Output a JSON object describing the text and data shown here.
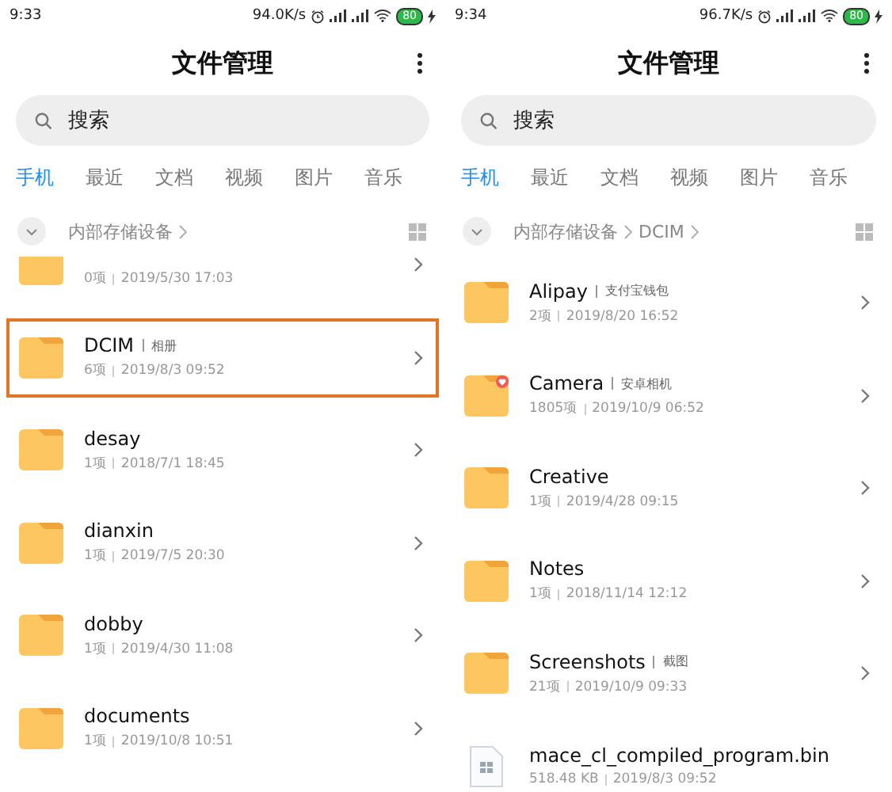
{
  "screens": [
    {
      "status_bar": {
        "time": "9:33",
        "speed": "94.0K/s",
        "battery": "80"
      },
      "title": "文件管理",
      "search": {
        "placeholder": "搜索"
      },
      "tabs": [
        {
          "label": "手机",
          "selected": true
        },
        {
          "label": "最近",
          "selected": false
        },
        {
          "label": "文档",
          "selected": false
        },
        {
          "label": "视频",
          "selected": false
        },
        {
          "label": "图片",
          "selected": false
        },
        {
          "label": "音乐",
          "selected": false
        }
      ],
      "breadcrumb": [
        "内部存储设备"
      ],
      "items": [
        {
          "kind": "folder",
          "info": "0项",
          "date": "2019/5/30 17:03",
          "highlighted": false
        },
        {
          "kind": "folder",
          "name": "DCIM",
          "tag": "相册",
          "info": "6项",
          "date": "2019/8/3 09:52",
          "highlighted": true,
          "favorite": false
        },
        {
          "kind": "folder",
          "name": "desay",
          "info": "1项",
          "date": "2018/7/1 18:45",
          "highlighted": false,
          "favorite": false
        },
        {
          "kind": "folder",
          "name": "dianxin",
          "info": "1项",
          "date": "2019/7/5 20:30",
          "highlighted": false,
          "favorite": false
        },
        {
          "kind": "folder",
          "name": "dobby",
          "info": "1项",
          "date": "2019/4/30 11:08",
          "highlighted": false,
          "favorite": false
        },
        {
          "kind": "folder",
          "name": "documents",
          "info": "1项",
          "date": "2019/10/8 10:51",
          "highlighted": false,
          "favorite": false
        }
      ]
    },
    {
      "status_bar": {
        "time": "9:34",
        "speed": "96.7K/s",
        "battery": "80"
      },
      "title": "文件管理",
      "search": {
        "placeholder": "搜索"
      },
      "tabs": [
        {
          "label": "手机",
          "selected": true
        },
        {
          "label": "最近",
          "selected": false
        },
        {
          "label": "文档",
          "selected": false
        },
        {
          "label": "视频",
          "selected": false
        },
        {
          "label": "图片",
          "selected": false
        },
        {
          "label": "音乐",
          "selected": false
        }
      ],
      "breadcrumb": [
        "内部存储设备",
        "DCIM"
      ],
      "items": [
        {
          "kind": "folder",
          "name": "Alipay",
          "tag": "支付宝钱包",
          "info": "2项",
          "date": "2019/8/20 16:52",
          "highlighted": false,
          "favorite": false
        },
        {
          "kind": "folder",
          "name": "Camera",
          "tag": "安卓相机",
          "info": "1805项",
          "date": "2019/10/9 06:52",
          "highlighted": false,
          "favorite": true
        },
        {
          "kind": "folder",
          "name": "Creative",
          "info": "1项",
          "date": "2019/4/28 09:15",
          "highlighted": false,
          "favorite": false
        },
        {
          "kind": "folder",
          "name": "Notes",
          "info": "1项",
          "date": "2018/11/14 12:12",
          "highlighted": false,
          "favorite": false
        },
        {
          "kind": "folder",
          "name": "Screenshots",
          "tag": "截图",
          "info": "21项",
          "date": "2019/10/9 09:33",
          "highlighted": false,
          "favorite": false
        },
        {
          "kind": "file",
          "name": "mace_cl_compiled_program.bin",
          "info": "518.48 KB",
          "date": "2019/8/3 09:52",
          "highlighted": false,
          "favorite": false
        }
      ]
    }
  ]
}
